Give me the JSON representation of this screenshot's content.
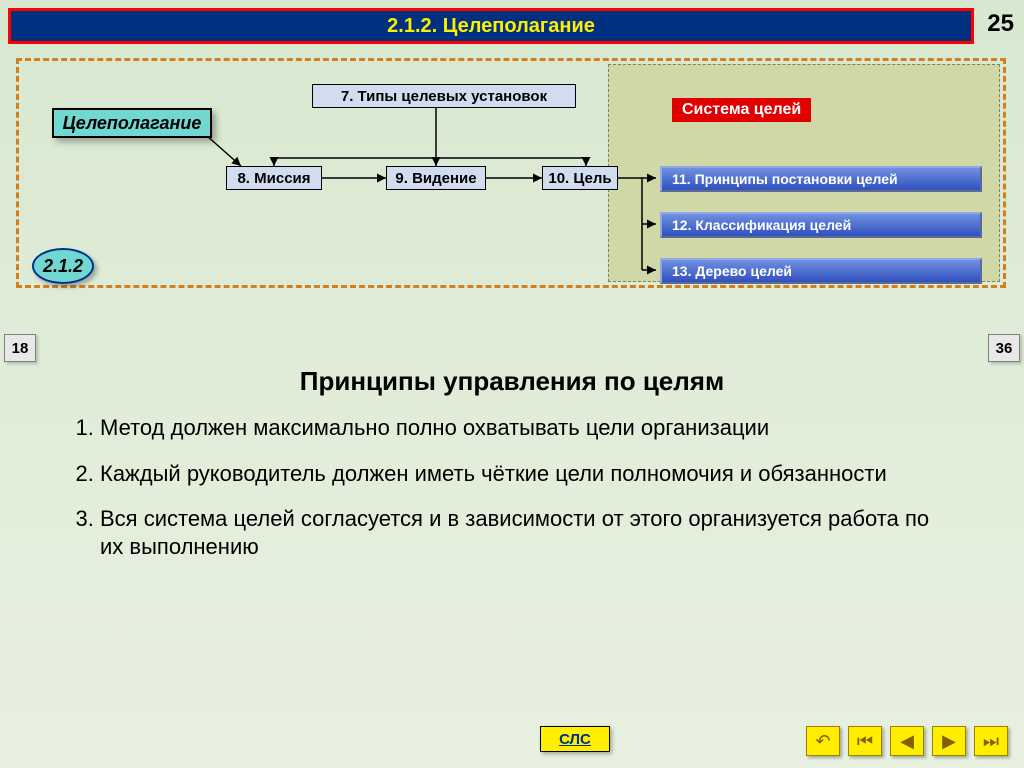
{
  "header": {
    "title": "2.1.2. Целеполагание",
    "page_number": "25"
  },
  "diagram": {
    "main": "Целеполагание",
    "system_label": "Система целей",
    "n7": "7. Типы целевых установок",
    "n8": "8. Миссия",
    "n9": "9. Видение",
    "n10": "10. Цель",
    "n11": "11. Принципы постановки целей",
    "n12": "12. Классификация целей",
    "n13": "13. Дерево целей",
    "badge": "2.1.2"
  },
  "nav": {
    "prev": "18",
    "next": "36"
  },
  "content": {
    "title": "Принципы управления по целям",
    "items": [
      "Метод должен максимально полно охватывать цели организации",
      "Каждый руководитель должен иметь чёткие цели полномочия и обязанности",
      "Вся система целей согласуется и в зависимости от этого организуется работа по их выполнению"
    ]
  },
  "footer": {
    "sls": "СЛС"
  }
}
